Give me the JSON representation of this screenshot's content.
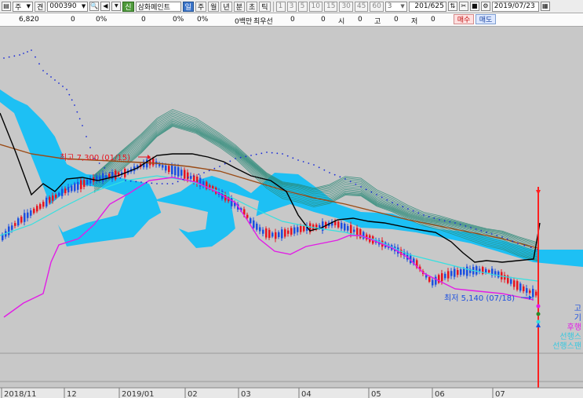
{
  "toolbar": {
    "market_select": "주",
    "stock_type": "견",
    "stock_code": "000390",
    "company_badge": "신",
    "company_name": "삼화페인트",
    "periods": [
      "일",
      "주",
      "월",
      "년",
      "분",
      "초",
      "틱"
    ],
    "active_period": "일",
    "intervals": [
      "1",
      "3",
      "5",
      "10",
      "15",
      "30",
      "45",
      "60"
    ],
    "count_value": "3",
    "range_value": "201/625",
    "date_value": "2019/07/23"
  },
  "infobar": {
    "price": "6,820",
    "change": "0",
    "change_pct": "0%",
    "volume": "0",
    "volume_pct": "0%",
    "amount_pct": "0%",
    "amount": "0백만",
    "best_quote_label": "최우선",
    "best_quote_1": "0",
    "best_quote_2": "0",
    "open_label": "시",
    "open": "0",
    "high_label": "고",
    "high": "0",
    "low_label": "저",
    "low": "0",
    "buy_label": "매수",
    "sell_label": "매도"
  },
  "chart": {
    "annotations": {
      "high_label": "최고 7,300 (01/15)",
      "low_label": "최저 5,140 (07/18)"
    },
    "right_legend": [
      "고",
      "기",
      "후행",
      "선행스",
      "선행스팬"
    ],
    "x_axis_labels": [
      "2018/11",
      "12",
      "2019/01",
      "02",
      "03",
      "04",
      "05",
      "06",
      "07"
    ],
    "colors": {
      "background": "#c8c8c8",
      "up_candle": "#e8141f",
      "down_candle": "#1b4fe0",
      "cloud": "#14c0f7",
      "ma_long": "#9a4a14",
      "conversion": "#000000",
      "lagging": "#e21ce6",
      "base_line": "#35e0e0",
      "leading_dots": "#1a2bd8",
      "ribbon": "#2a8a78",
      "cursor_line": "#ff2020"
    }
  }
}
